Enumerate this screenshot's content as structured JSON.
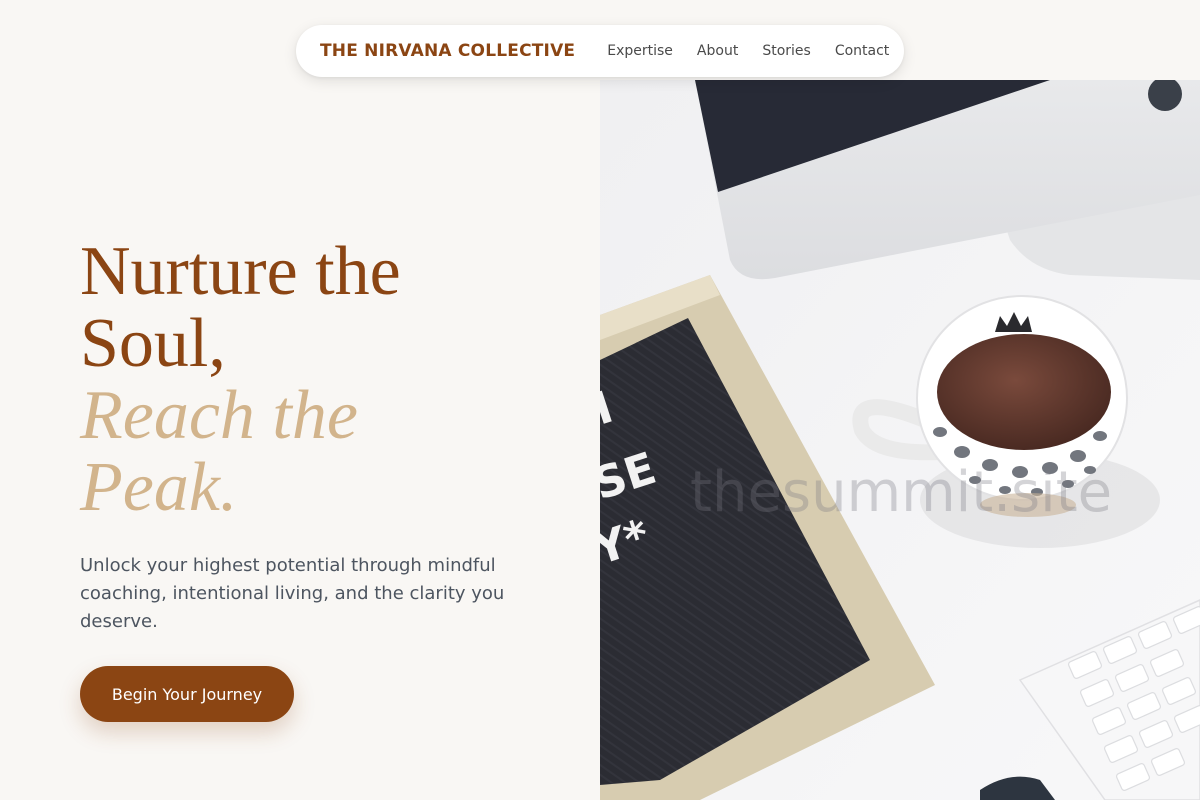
{
  "nav": {
    "brand": "THE NIRVANA COLLECTIVE",
    "links": [
      "Expertise",
      "About",
      "Stories",
      "Contact"
    ]
  },
  "hero": {
    "headline_line1": "Nurture the",
    "headline_line2": "Soul,",
    "headline_line3": "Reach the",
    "headline_line4": "Peak.",
    "subtext": "Unlock your highest potential through mindful coaching, intentional living, and the clarity you deserve.",
    "cta_label": "Begin Your Journey"
  },
  "image": {
    "watermark": "thesummit.site",
    "letterboard_letters": [
      "I",
      "SE",
      "Y*"
    ]
  },
  "colors": {
    "brand": "#8b4513",
    "accent_tan": "#d2b48c",
    "background": "#f9f7f4",
    "body_text": "#4d5560"
  }
}
